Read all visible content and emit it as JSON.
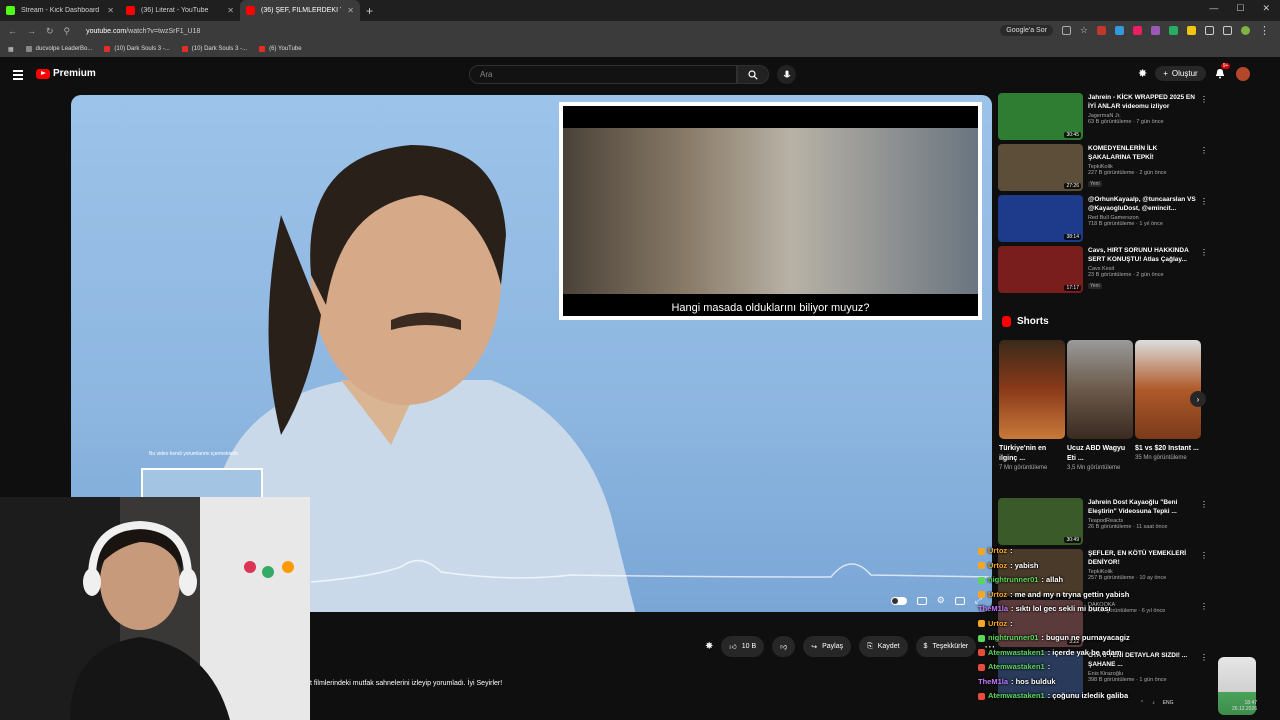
{
  "browser": {
    "tabs": [
      {
        "title": "Stream - Kick Dashboard",
        "color": "#53fc18",
        "active": false
      },
      {
        "title": "(36) Literat - YouTube",
        "color": "#ff0000",
        "active": false
      },
      {
        "title": "(36) ŞEF, FİLMLERDEKİ YEM...",
        "color": "#ff0000",
        "active": true
      }
    ],
    "url_host": "youtube.com",
    "url_path": "/watch?v=twzSrF1_U18",
    "search_button": "Google'a Sor",
    "bookmarks": [
      "ducvolpe LeaderBo...",
      "(10) Dark Souls 3 -...",
      "(10) Dark Souls 3 -...",
      "(6) YouTube"
    ]
  },
  "header": {
    "logo": "Premium",
    "search_placeholder": "Ara",
    "create_label": "Oluştur",
    "notif_count": "9+"
  },
  "video": {
    "clip_subtitle": "Hangi masada olduklarını biliyor muyuz?",
    "mini_caption": "Bu video kendi yorumlarımı içermektedir",
    "like_count": "10 B",
    "share_label": "Paylaş",
    "save_label": "Kaydet",
    "thanks_label": "Teşekkürler",
    "description": "t filmlerindeki mutfak sahnelerini izleyip yorumladı. İyi Seyirler!"
  },
  "recommendations": [
    {
      "title": "Jahrein - KİCK WRAPPED 2025 EN İYİ ANLAR videomu izliyor",
      "channel": "JagermaN Jr.",
      "views": "63 B görüntüleme · 7 gün önce",
      "duration": "30:45",
      "badge": "",
      "color": "#2e7d32"
    },
    {
      "title": "KOMEDYENLERİN İLK ŞAKALARINA TEPKİ!",
      "channel": "TepkiKolik",
      "views": "227 B görüntüleme · 2 gün önce",
      "duration": "27:26",
      "badge": "Yeni",
      "color": "#5d4e3a"
    },
    {
      "title": "@OrhunKayaalp, @tuncaarslan VS @KayaogluDost, @emincit...",
      "channel": "Red Bull Gamerszon",
      "views": "718 B görüntüleme · 1 yıl önce",
      "duration": "38:14",
      "badge": "",
      "color": "#1e3a8a"
    },
    {
      "title": "Cavs, HIRT SORUNU HAKKINDA SERT KONUŞTU! Atlas Çağlay...",
      "channel": "Cavs Kesit",
      "views": "23 B görüntüleme · 2 gün önce",
      "duration": "17:17",
      "badge": "Yeni",
      "color": "#7a1d1d"
    }
  ],
  "shorts": {
    "heading": "Shorts",
    "items": [
      {
        "title": "Türkiye'nin en ilginç ...",
        "views": "7 Mn görüntüleme",
        "color": "#8b3a1a"
      },
      {
        "title": "Ucuz ABD Wagyu Eti ...",
        "views": "3,5 Mn görüntüleme",
        "color": "#6b5a4a"
      },
      {
        "title": "$1 vs $20 Instant ...",
        "views": "35 Mn görüntüleme",
        "color": "#b05a2a"
      }
    ]
  },
  "recommendations2": [
    {
      "title": "Jahrein Dost Kayaoğlu \"Beni Eleştirin\" Videosuna Tepki ...",
      "channel": "TeapodReacts",
      "views": "26 B görüntüleme · 11 saat önce",
      "duration": "30:49",
      "color": "#3a5a2a"
    },
    {
      "title": "ŞEFLER, EN KÖTÜ YEMEKLERİ DENİYOR!",
      "channel": "TepkiKolik",
      "views": "257 B görüntüleme · 10 ay önce",
      "duration": "",
      "color": "#4a3a2a"
    },
    {
      "title": "",
      "channel": "DAKOOKA",
      "views": "6,1 Mn görüntüleme · 6 yıl önce",
      "duration": "3:22",
      "color": "#5a3a3a"
    },
    {
      "title": "GTA 6 YENİ DETAYLAR SIZDI! ... ŞAHANE ...",
      "channel": "Enis Kirazoğlu",
      "views": "398 B görüntüleme · 1 gün önce",
      "duration": "",
      "color": "#2a3a5a"
    }
  ],
  "chat": [
    {
      "user": "Urtoz",
      "msg": ":",
      "color": "#f5a623"
    },
    {
      "user": "Urtoz",
      "msg": ": yabish",
      "color": "#f5a623"
    },
    {
      "user": "nightrunner01",
      "msg": ": allah",
      "color": "#5ad85a"
    },
    {
      "user": "Urtoz",
      "msg": ": me and my n tryna gettin yabish",
      "color": "#f5a623"
    },
    {
      "user": "TheM1la",
      "msg": ": sıktı lol gec sekli mi burası",
      "color": "#c37bff"
    },
    {
      "user": "Urtoz",
      "msg": ":",
      "color": "#f5a623"
    },
    {
      "user": "nightrunner01",
      "msg": ": bugun ne purnayacagiz",
      "color": "#5ad85a"
    },
    {
      "user": "Atemwastaken1",
      "msg": ": içerde yak be adam",
      "color": "#5ad85a"
    },
    {
      "user": "Atemwastaken1",
      "msg": ":",
      "color": "#5ad85a"
    },
    {
      "user": "TheM1la",
      "msg": ": hos bulduk",
      "color": "#c37bff"
    },
    {
      "user": "Atemwastaken1",
      "msg": ": çoğunu izledik galiba",
      "color": "#5ad85a"
    }
  ],
  "system": {
    "lang": "ENG",
    "time": "18:47",
    "date": "26.12.2026"
  }
}
